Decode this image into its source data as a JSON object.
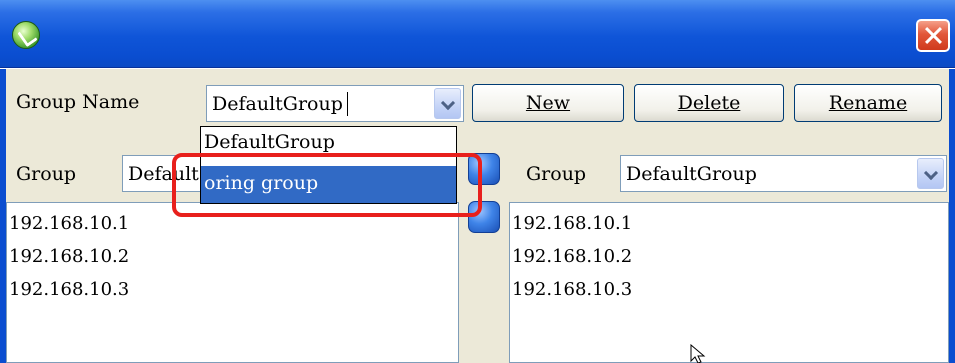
{
  "window": {
    "title_icon": "app-leaf-icon",
    "close_icon": "close-icon"
  },
  "group_name": {
    "label": "Group Name",
    "value": "DefaultGroup",
    "dropdown_options": [
      "DefaultGroup",
      "oring group"
    ],
    "highlighted_option": "oring group"
  },
  "toolbar": {
    "new_label": "New",
    "delete_label": "Delete",
    "rename_label": "Rename"
  },
  "left_panel": {
    "group_label": "Group",
    "group_value_partial": "Default",
    "items": [
      "192.168.10.1",
      "192.168.10.2",
      "192.168.10.3"
    ]
  },
  "right_panel": {
    "group_label": "Group",
    "group_value": "DefaultGroup",
    "items": [
      "192.168.10.1",
      "192.168.10.2",
      "192.168.10.3"
    ]
  },
  "colors": {
    "titlebar": "#0a4dd0",
    "selection": "#316ac5",
    "highlight_box": "#e8201c"
  }
}
